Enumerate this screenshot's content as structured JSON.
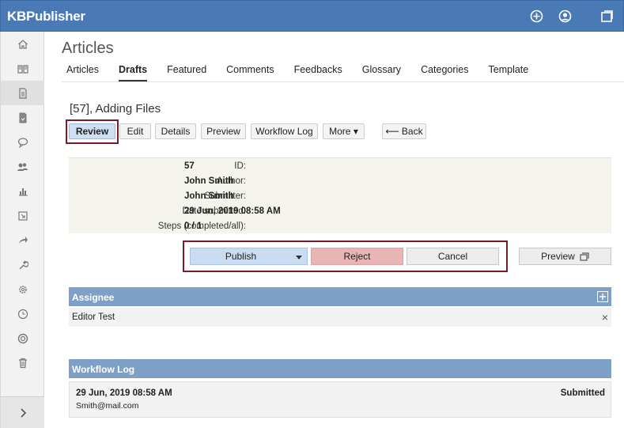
{
  "app": {
    "brand": "KBPublisher"
  },
  "header_icons": [
    "plus-circle-icon",
    "user-icon",
    "window-icon"
  ],
  "sidebar": {
    "items": [
      {
        "icon": "home-icon"
      },
      {
        "icon": "book-icon"
      },
      {
        "icon": "document-icon",
        "active": true
      },
      {
        "icon": "file-icon"
      },
      {
        "icon": "comment-icon"
      },
      {
        "icon": "users-icon"
      },
      {
        "icon": "bar-chart-icon"
      },
      {
        "icon": "import-icon"
      },
      {
        "icon": "share-arrow-icon"
      },
      {
        "icon": "wrench-icon"
      },
      {
        "icon": "gear-icon"
      },
      {
        "icon": "clock-icon"
      },
      {
        "icon": "lifebuoy-icon"
      },
      {
        "icon": "trash-icon"
      }
    ],
    "expand_icon": "chevron-right-icon"
  },
  "page": {
    "title": "Articles",
    "tabs": [
      {
        "label": "Articles"
      },
      {
        "label": "Drafts",
        "active": true
      },
      {
        "label": "Featured"
      },
      {
        "label": "Comments"
      },
      {
        "label": "Feedbacks"
      },
      {
        "label": "Glossary"
      },
      {
        "label": "Categories"
      },
      {
        "label": "Template"
      }
    ]
  },
  "article": {
    "title": "[57], Adding Files",
    "buttons": {
      "review": "Review",
      "edit": "Edit",
      "details": "Details",
      "preview": "Preview",
      "workflow_log": "Workflow Log",
      "more": "More ▾",
      "back": "⟵ Back"
    },
    "info": [
      {
        "label": "ID:",
        "value": "57"
      },
      {
        "label": "Author:",
        "value": "John Smith"
      },
      {
        "label": "Submitter:",
        "value": "John Smith"
      },
      {
        "label": "Date submitted:",
        "value": "29 Jun, 2019 08:58 AM"
      },
      {
        "label": "Steps (completed/all):",
        "value": "0 / 1"
      }
    ]
  },
  "actions": {
    "publish": "Publish",
    "reject": "Reject",
    "cancel": "Cancel",
    "preview": "Preview",
    "colors": {
      "publish": "#c9dcf2",
      "reject": "#e8b4b4",
      "cancel": "#ececec"
    }
  },
  "assignee": {
    "header": "Assignee",
    "name": "Editor Test",
    "remove": "×"
  },
  "workflow_log": {
    "header": "Workflow Log",
    "entry": {
      "date": "29 Jun, 2019 08:58 AM",
      "email": "Smith@mail.com",
      "status": "Submitted"
    }
  }
}
